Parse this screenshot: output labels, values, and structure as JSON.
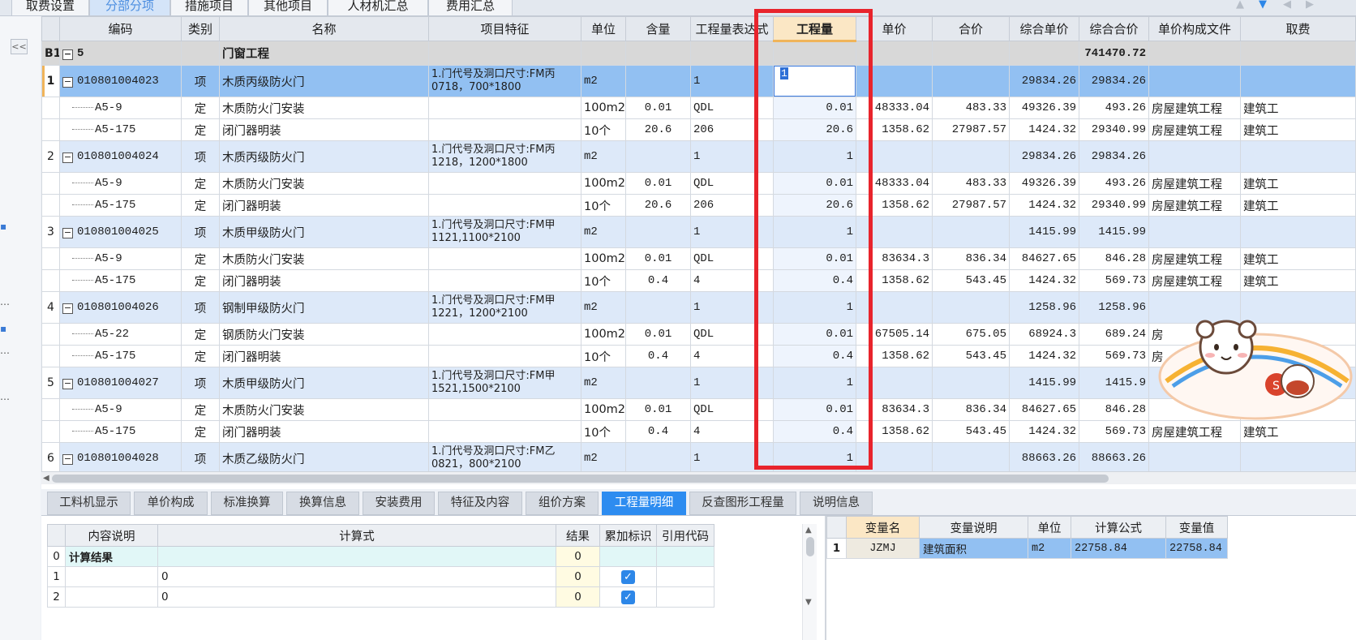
{
  "top_tabs": [
    {
      "label": "取费设置",
      "active": false
    },
    {
      "label": "分部分项",
      "active": true
    },
    {
      "label": "措施项目",
      "active": false
    },
    {
      "label": "其他项目",
      "active": false
    },
    {
      "label": "人材机汇总",
      "active": false
    },
    {
      "label": "费用汇总",
      "active": false
    }
  ],
  "sidebar": {
    "collapse_glyph": "<<"
  },
  "grid": {
    "columns": [
      "编码",
      "类别",
      "名称",
      "项目特征",
      "单位",
      "含量",
      "工程量表达式",
      "工程量",
      "单价",
      "合价",
      "综合单价",
      "综合合价",
      "单价构成文件",
      "取费"
    ],
    "group": {
      "row_no": "B1",
      "code": "5",
      "name": "门窗工程",
      "total": "741470.72"
    },
    "items": [
      {
        "no": "1",
        "code": "010801004023",
        "type": "项",
        "name": "木质丙级防火门",
        "feature": "1.门代号及洞口尺寸:FM丙0718，700*1800",
        "unit": "m2",
        "expr": "1",
        "qty": "1",
        "uprice": "29834.26",
        "utotal": "29834.26",
        "selected": true,
        "subs": [
          {
            "code": "A5-9",
            "type": "定",
            "name": "木质防火门安装",
            "unit": "100m2",
            "content": "0.01",
            "expr": "QDL",
            "qty": "0.01",
            "price": "48333.04",
            "total": "483.33",
            "uprice": "49326.39",
            "utotal": "493.26",
            "file": "房屋建筑工程",
            "fee": "建筑工"
          },
          {
            "code": "A5-175",
            "type": "定",
            "name": "闭门器明装",
            "unit": "10个",
            "content": "20.6",
            "expr": "206",
            "qty": "20.6",
            "price": "1358.62",
            "total": "27987.57",
            "uprice": "1424.32",
            "utotal": "29340.99",
            "file": "房屋建筑工程",
            "fee": "建筑工"
          }
        ]
      },
      {
        "no": "2",
        "code": "010801004024",
        "type": "项",
        "name": "木质丙级防火门",
        "feature": "1.门代号及洞口尺寸:FM丙1218，1200*1800",
        "unit": "m2",
        "expr": "1",
        "qty": "1",
        "uprice": "29834.26",
        "utotal": "29834.26",
        "selected": false,
        "subs": [
          {
            "code": "A5-9",
            "type": "定",
            "name": "木质防火门安装",
            "unit": "100m2",
            "content": "0.01",
            "expr": "QDL",
            "qty": "0.01",
            "price": "48333.04",
            "total": "483.33",
            "uprice": "49326.39",
            "utotal": "493.26",
            "file": "房屋建筑工程",
            "fee": "建筑工"
          },
          {
            "code": "A5-175",
            "type": "定",
            "name": "闭门器明装",
            "unit": "10个",
            "content": "20.6",
            "expr": "206",
            "qty": "20.6",
            "price": "1358.62",
            "total": "27987.57",
            "uprice": "1424.32",
            "utotal": "29340.99",
            "file": "房屋建筑工程",
            "fee": "建筑工"
          }
        ]
      },
      {
        "no": "3",
        "code": "010801004025",
        "type": "项",
        "name": "木质甲级防火门",
        "feature": "1.门代号及洞口尺寸:FM甲1121,1100*2100",
        "unit": "m2",
        "expr": "1",
        "qty": "1",
        "uprice": "1415.99",
        "utotal": "1415.99",
        "selected": false,
        "subs": [
          {
            "code": "A5-9",
            "type": "定",
            "name": "木质防火门安装",
            "unit": "100m2",
            "content": "0.01",
            "expr": "QDL",
            "qty": "0.01",
            "price": "83634.3",
            "total": "836.34",
            "uprice": "84627.65",
            "utotal": "846.28",
            "file": "房屋建筑工程",
            "fee": "建筑工"
          },
          {
            "code": "A5-175",
            "type": "定",
            "name": "闭门器明装",
            "unit": "10个",
            "content": "0.4",
            "expr": "4",
            "qty": "0.4",
            "price": "1358.62",
            "total": "543.45",
            "uprice": "1424.32",
            "utotal": "569.73",
            "file": "房屋建筑工程",
            "fee": "建筑工"
          }
        ]
      },
      {
        "no": "4",
        "code": "010801004026",
        "type": "项",
        "name": "钢制甲级防火门",
        "feature": "1.门代号及洞口尺寸:FM甲1221，1200*2100",
        "unit": "m2",
        "expr": "1",
        "qty": "1",
        "uprice": "1258.96",
        "utotal": "1258.96",
        "selected": false,
        "subs": [
          {
            "code": "A5-22",
            "type": "定",
            "name": "钢质防火门安装",
            "unit": "100m2",
            "content": "0.01",
            "expr": "QDL",
            "qty": "0.01",
            "price": "67505.14",
            "total": "675.05",
            "uprice": "68924.3",
            "utotal": "689.24",
            "file": "房",
            "fee": "工"
          },
          {
            "code": "A5-175",
            "type": "定",
            "name": "闭门器明装",
            "unit": "10个",
            "content": "0.4",
            "expr": "4",
            "qty": "0.4",
            "price": "1358.62",
            "total": "543.45",
            "uprice": "1424.32",
            "utotal": "569.73",
            "file": "房",
            "fee": "工"
          }
        ]
      },
      {
        "no": "5",
        "code": "010801004027",
        "type": "项",
        "name": "木质甲级防火门",
        "feature": "1.门代号及洞口尺寸:FM甲1521,1500*2100",
        "unit": "m2",
        "expr": "1",
        "qty": "1",
        "uprice": "1415.99",
        "utotal": "1415.9",
        "selected": false,
        "subs": [
          {
            "code": "A5-9",
            "type": "定",
            "name": "木质防火门安装",
            "unit": "100m2",
            "content": "0.01",
            "expr": "QDL",
            "qty": "0.01",
            "price": "83634.3",
            "total": "836.34",
            "uprice": "84627.65",
            "utotal": "846.28",
            "file": "",
            "fee": ""
          },
          {
            "code": "A5-175",
            "type": "定",
            "name": "闭门器明装",
            "unit": "10个",
            "content": "0.4",
            "expr": "4",
            "qty": "0.4",
            "price": "1358.62",
            "total": "543.45",
            "uprice": "1424.32",
            "utotal": "569.73",
            "file": "房屋建筑工程",
            "fee": "建筑工"
          }
        ]
      },
      {
        "no": "6",
        "code": "010801004028",
        "type": "项",
        "name": "木质乙级防火门",
        "feature": "1.门代号及洞口尺寸:FM乙0821，800*2100",
        "unit": "m2",
        "expr": "1",
        "qty": "1",
        "uprice": "88663.26",
        "utotal": "88663.26",
        "selected": false,
        "subs": []
      }
    ]
  },
  "editing_qty": "1",
  "bottom_tabs": [
    {
      "label": "工料机显示",
      "active": false
    },
    {
      "label": "单价构成",
      "active": false
    },
    {
      "label": "标准换算",
      "active": false
    },
    {
      "label": "换算信息",
      "active": false
    },
    {
      "label": "安装费用",
      "active": false
    },
    {
      "label": "特征及内容",
      "active": false
    },
    {
      "label": "组价方案",
      "active": false
    },
    {
      "label": "工程量明细",
      "active": true
    },
    {
      "label": "反查图形工程量",
      "active": false
    },
    {
      "label": "说明信息",
      "active": false
    }
  ],
  "qty_detail": {
    "columns": [
      "内容说明",
      "计算式",
      "结果",
      "累加标识",
      "引用代码"
    ],
    "rows": [
      {
        "no": "0",
        "desc": "计算结果",
        "formula": "",
        "result": "0",
        "checked": false
      },
      {
        "no": "1",
        "desc": "",
        "formula": "0",
        "result": "0",
        "checked": true
      },
      {
        "no": "2",
        "desc": "",
        "formula": "0",
        "result": "0",
        "checked": true
      }
    ]
  },
  "variables": {
    "columns": [
      "变量名",
      "变量说明",
      "单位",
      "计算公式",
      "变量值"
    ],
    "rows": [
      {
        "no": "1",
        "name": "JZMJ",
        "desc": "建筑面积",
        "unit": "m2",
        "formula": "22758.84",
        "value": "22758.84"
      }
    ]
  }
}
